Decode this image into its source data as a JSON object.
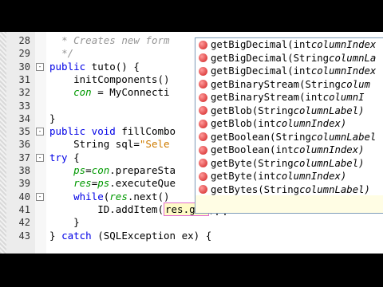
{
  "editor": {
    "lines": [
      {
        "num": "28",
        "code": [
          {
            "t": "  ",
            "c": ""
          },
          {
            "t": "* Creates new form ",
            "c": "cm"
          }
        ]
      },
      {
        "num": "29",
        "code": [
          {
            "t": "  ",
            "c": ""
          },
          {
            "t": "*/",
            "c": "cm"
          }
        ]
      },
      {
        "num": "30",
        "code": [
          {
            "t": "public",
            "c": "kw"
          },
          {
            "t": " tuto() {",
            "c": ""
          }
        ]
      },
      {
        "num": "31",
        "code": [
          {
            "t": "    initComponents()",
            "c": ""
          }
        ]
      },
      {
        "num": "32",
        "code": [
          {
            "t": "    ",
            "c": ""
          },
          {
            "t": "con",
            "c": "fld"
          },
          {
            "t": " = MyConnecti",
            "c": ""
          }
        ]
      },
      {
        "num": "33",
        "code": []
      },
      {
        "num": "34",
        "code": [
          {
            "t": "}",
            "c": ""
          }
        ]
      },
      {
        "num": "35",
        "code": [
          {
            "t": "public void",
            "c": "kw"
          },
          {
            "t": " fillCombo",
            "c": ""
          }
        ]
      },
      {
        "num": "36",
        "code": [
          {
            "t": "    String sql=",
            "c": ""
          },
          {
            "t": "\"Sele",
            "c": "str"
          }
        ]
      },
      {
        "num": "37",
        "code": [
          {
            "t": "try",
            "c": "kw"
          },
          {
            "t": " {",
            "c": ""
          }
        ]
      },
      {
        "num": "38",
        "code": [
          {
            "t": "    ",
            "c": ""
          },
          {
            "t": "ps",
            "c": "fld"
          },
          {
            "t": "=",
            "c": ""
          },
          {
            "t": "con",
            "c": "fld"
          },
          {
            "t": ".prepareSta",
            "c": ""
          }
        ]
      },
      {
        "num": "39",
        "code": [
          {
            "t": "    ",
            "c": ""
          },
          {
            "t": "res",
            "c": "fld"
          },
          {
            "t": "=",
            "c": ""
          },
          {
            "t": "ps",
            "c": "fld"
          },
          {
            "t": ".executeQue",
            "c": ""
          }
        ]
      },
      {
        "num": "40",
        "code": [
          {
            "t": "    ",
            "c": ""
          },
          {
            "t": "while",
            "c": "kw"
          },
          {
            "t": "(",
            "c": ""
          },
          {
            "t": "res",
            "c": "fld"
          },
          {
            "t": ".next()",
            "c": ""
          }
        ]
      },
      {
        "num": "41",
        "code": [
          {
            "t": "        ID.addItem(",
            "c": ""
          },
          {
            "t": "res.get",
            "c": "hl"
          },
          {
            "t": ")",
            "c": ""
          }
        ]
      },
      {
        "num": "42",
        "code": [
          {
            "t": "    }",
            "c": ""
          }
        ]
      },
      {
        "num": "43",
        "code": [
          {
            "t": "} ",
            "c": ""
          },
          {
            "t": "catch",
            "c": "kw"
          },
          {
            "t": " (SQLException ex) {",
            "c": ""
          }
        ]
      }
    ]
  },
  "autocomplete": {
    "items": [
      {
        "name": "getBigDecimal",
        "ptype": "int",
        "pname": "columnIndex"
      },
      {
        "name": "getBigDecimal",
        "ptype": "String",
        "pname": "columnLa"
      },
      {
        "name": "getBigDecimal",
        "ptype": "int",
        "pname": "columnIndex"
      },
      {
        "name": "getBinaryStream",
        "ptype": "String",
        "pname": "colum"
      },
      {
        "name": "getBinaryStream",
        "ptype": "int",
        "pname": "columnI"
      },
      {
        "name": "getBlob",
        "ptype": "String",
        "pname": "columnLabel)"
      },
      {
        "name": "getBlob",
        "ptype": "int",
        "pname": "columnIndex)"
      },
      {
        "name": "getBoolean",
        "ptype": "String",
        "pname": "columnLabel"
      },
      {
        "name": "getBoolean",
        "ptype": "int",
        "pname": "columnIndex)"
      },
      {
        "name": "getByte",
        "ptype": "String",
        "pname": "columnLabel)"
      },
      {
        "name": "getByte",
        "ptype": "int",
        "pname": "columnIndex)"
      },
      {
        "name": "getBytes",
        "ptype": "String",
        "pname": "columnLabel)"
      }
    ]
  }
}
